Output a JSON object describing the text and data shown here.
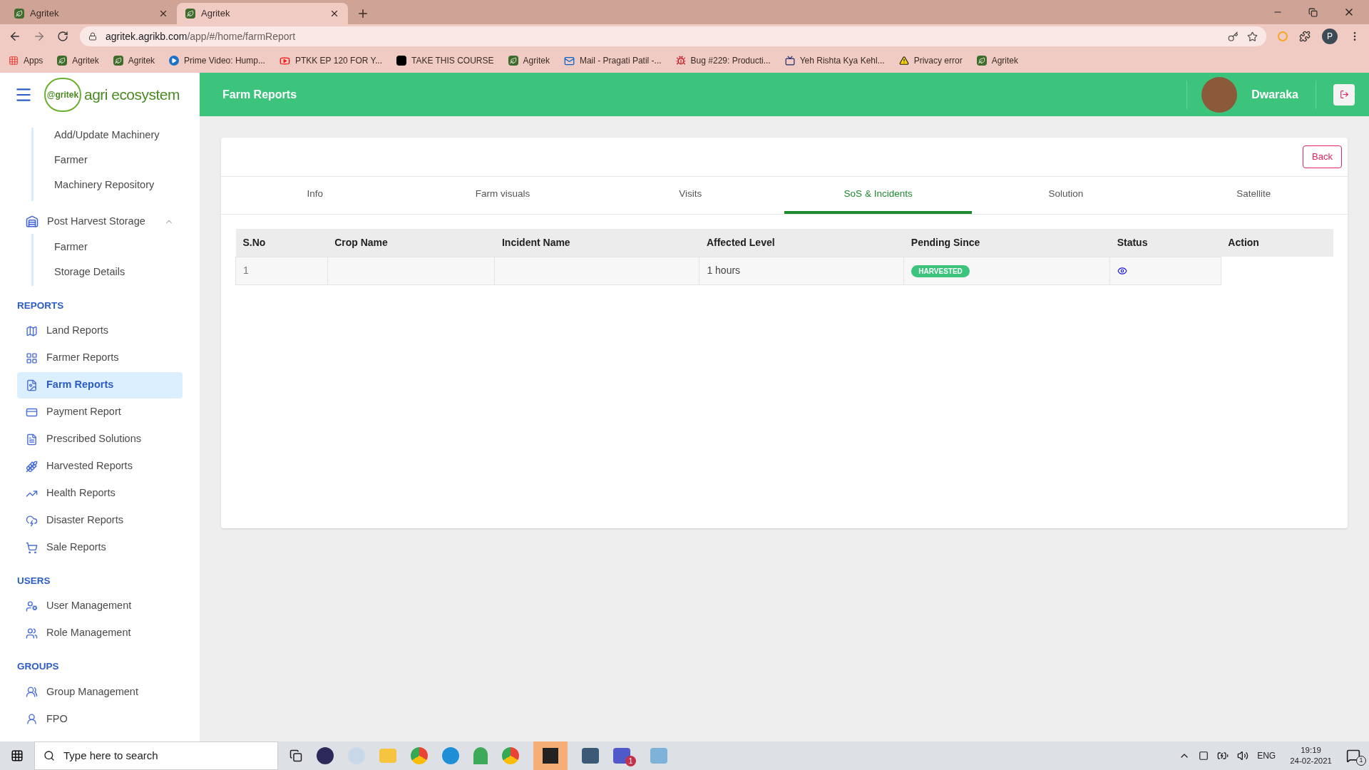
{
  "browser": {
    "tabs": [
      {
        "title": "Agritek",
        "selected": false
      },
      {
        "title": "Agritek",
        "selected": true
      }
    ],
    "url_host": "agritek.agrikb.com",
    "url_path": "/app/#/home/farmReport",
    "profile": "P",
    "bookmarks": [
      {
        "label": "Apps",
        "kind": "apps"
      },
      {
        "label": "Agritek",
        "kind": "site"
      },
      {
        "label": "Agritek",
        "kind": "site"
      },
      {
        "label": "Prime Video: Hump...",
        "kind": "play"
      },
      {
        "label": "PTKK EP 120 FOR Y...",
        "kind": "video"
      },
      {
        "label": "TAKE THIS COURSE",
        "kind": "course"
      },
      {
        "label": "Agritek",
        "kind": "site"
      },
      {
        "label": "Mail - Pragati Patil -...",
        "kind": "mail"
      },
      {
        "label": "Bug #229: Producti...",
        "kind": "bug"
      },
      {
        "label": "Yeh Rishta Kya Kehl...",
        "kind": "tv"
      },
      {
        "label": "Privacy error",
        "kind": "warning"
      },
      {
        "label": "Agritek",
        "kind": "site"
      }
    ]
  },
  "app": {
    "logo_badge": "@gritek",
    "logo_text": "agri ecosystem",
    "page_title": "Farm Reports",
    "user": "Dwaraka"
  },
  "sidebar": {
    "continued_children": [
      {
        "label": "Add/Update Machinery"
      },
      {
        "label": "Farmer"
      },
      {
        "label": "Machinery Repository"
      }
    ],
    "groups": [
      {
        "label": "Post Harvest Storage",
        "expanded": true,
        "children": [
          {
            "label": "Farmer"
          },
          {
            "label": "Storage Details"
          }
        ]
      }
    ],
    "sections": [
      {
        "heading": "REPORTS",
        "items": [
          {
            "label": "Land Reports",
            "selected": false
          },
          {
            "label": "Farmer Reports",
            "selected": false
          },
          {
            "label": "Farm Reports",
            "selected": true
          },
          {
            "label": "Payment Report",
            "selected": false
          },
          {
            "label": "Prescribed Solutions",
            "selected": false
          },
          {
            "label": "Harvested Reports",
            "selected": false
          },
          {
            "label": "Health Reports",
            "selected": false
          },
          {
            "label": "Disaster Reports",
            "selected": false
          },
          {
            "label": "Sale Reports",
            "selected": false
          }
        ]
      },
      {
        "heading": "USERS",
        "items": [
          {
            "label": "User Management",
            "selected": false
          },
          {
            "label": "Role Management",
            "selected": false
          }
        ]
      },
      {
        "heading": "GROUPS",
        "items": [
          {
            "label": "Group Management",
            "selected": false
          },
          {
            "label": "FPO",
            "selected": false
          }
        ]
      }
    ]
  },
  "card": {
    "back_button": "Back",
    "tabs": [
      {
        "label": "Info",
        "selected": false
      },
      {
        "label": "Farm visuals",
        "selected": false
      },
      {
        "label": "Visits",
        "selected": false
      },
      {
        "label": "SoS & Incidents",
        "selected": true
      },
      {
        "label": "Solution",
        "selected": false
      },
      {
        "label": "Satellite",
        "selected": false
      }
    ],
    "table": {
      "columns": [
        "S.No",
        "Crop Name",
        "Incident Name",
        "Affected Level",
        "Pending Since",
        "Status",
        "Action"
      ],
      "rows": [
        {
          "s_no": "1",
          "crop_name": "",
          "incident_name": "",
          "affected_level": "1 hours",
          "pending_since": "HARVESTED"
        }
      ]
    }
  },
  "taskbar": {
    "search_placeholder": "Type here to search",
    "teams_badge": "1",
    "language": "ENG",
    "time": "19:19",
    "date": "24-02-2021",
    "notifications": "1"
  }
}
